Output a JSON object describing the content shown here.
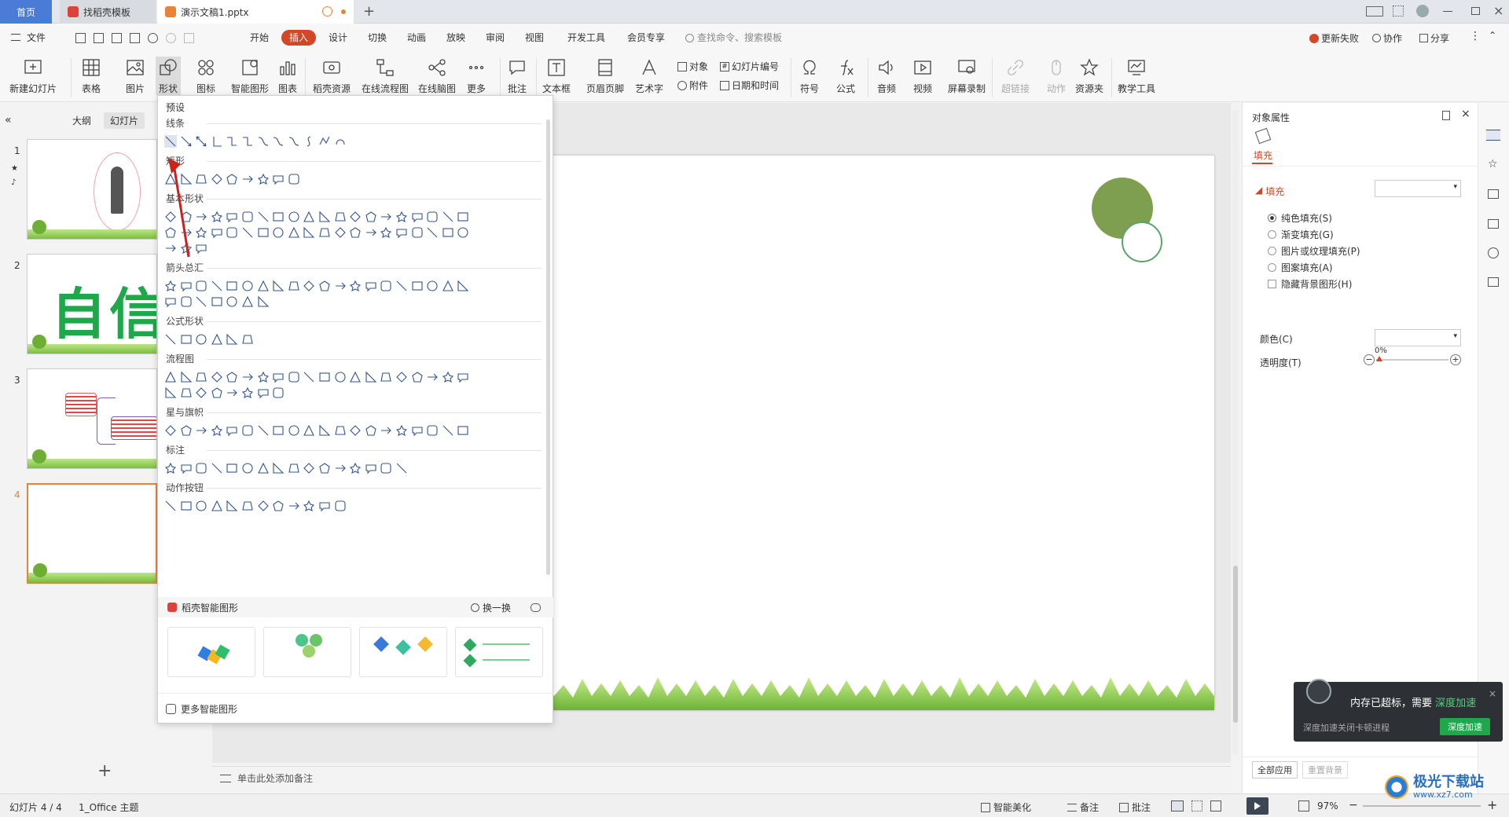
{
  "tabs": [
    {
      "label": "首页"
    },
    {
      "label": "找稻壳模板"
    },
    {
      "label": "演示文稿1.pptx"
    }
  ],
  "menu": [
    "文件",
    "开始",
    "插入",
    "设计",
    "切换",
    "动画",
    "放映",
    "审阅",
    "视图",
    "开发工具",
    "会员专享"
  ],
  "search_placeholder": "查找命令、搜索模板",
  "top_right": {
    "update_fail": "更新失败",
    "collab": "协作",
    "share": "分享"
  },
  "ribbon": {
    "new_slide": "新建幻灯片",
    "table": "表格",
    "picture": "图片",
    "shape": "形状",
    "icon": "图标",
    "smartart": "智能图形",
    "chart": "图表",
    "daoke_res": "稻壳资源",
    "online_flow": "在线流程图",
    "online_mind": "在线脑图",
    "more": "更多",
    "comment": "批注",
    "textbox": "文本框",
    "header_footer": "页眉页脚",
    "wordart": "艺术字",
    "object": "对象",
    "slide_number": "幻灯片编号",
    "attachment": "附件",
    "datetime": "日期和时间",
    "symbol": "符号",
    "formula": "公式",
    "audio": "音频",
    "video": "视频",
    "screen_rec": "屏幕录制",
    "hyperlink": "超链接",
    "action": "动作",
    "res_folder": "资源夹",
    "teach_tools": "教学工具"
  },
  "left_panel": {
    "outline": "大纲",
    "slides": "幻灯片",
    "numbers": [
      "1",
      "2",
      "3",
      "4"
    ]
  },
  "slide2_text": "自信",
  "notes_placeholder": "单击此处添加备注",
  "shape_panel": {
    "preset": "预设",
    "sections": [
      "线条",
      "矩形",
      "基本形状",
      "箭头总汇",
      "公式形状",
      "流程图",
      "星与旗帜",
      "标注",
      "动作按钮"
    ],
    "smart_title": "稻壳智能图形",
    "refresh": "换一换",
    "more_smart": "更多智能图形"
  },
  "right_panel": {
    "title": "对象属性",
    "tab_fill": "填充",
    "fill_section": "填充",
    "options": [
      "纯色填充(S)",
      "渐变填充(G)",
      "图片或纹理填充(P)",
      "图案填充(A)"
    ],
    "hide_bg": "隐藏背景图形(H)",
    "color_label": "颜色(C)",
    "transparency_label": "透明度(T)",
    "transparency_value": "0%",
    "apply_all": "全部应用",
    "reset_bg": "重置背景"
  },
  "toast": {
    "title": "内存已超标，需要",
    "title_link": "深度加速",
    "desc": "深度加速关闭卡顿进程",
    "button": "深度加速"
  },
  "status": {
    "slide_counter": "幻灯片 4 / 4",
    "theme": "1_Office 主题",
    "beautify": "智能美化",
    "notes": "备注",
    "comments": "批注",
    "zoom": "97%"
  },
  "watermark": {
    "brand": "极光下载站",
    "url": "www.xz7.com"
  },
  "colors": {
    "accent": "#d24726",
    "green_circle": "#7f9f50",
    "selection": "#e8833a"
  }
}
